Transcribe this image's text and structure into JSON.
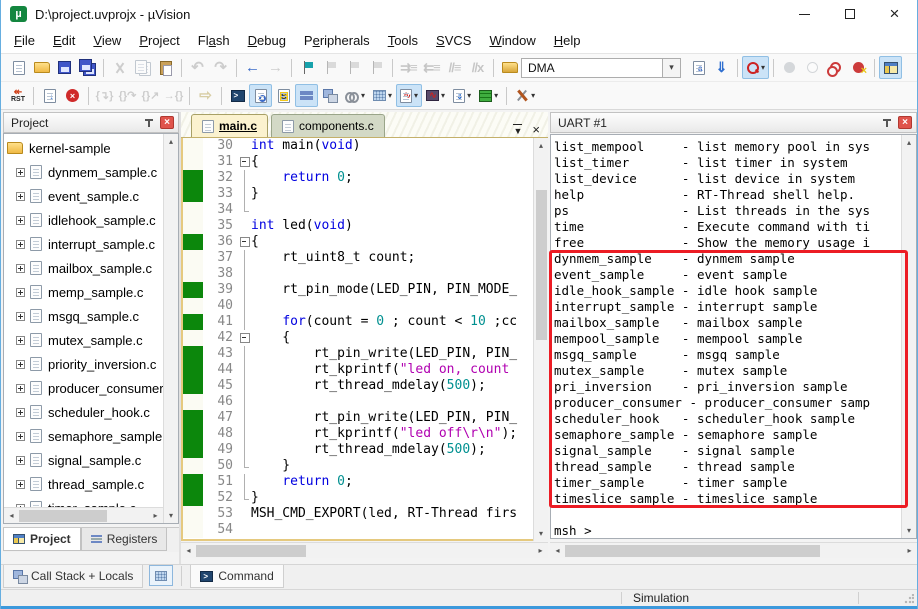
{
  "window": {
    "title": "D:\\project.uvprojx - µVision"
  },
  "menu": {
    "items": [
      {
        "label": "File",
        "u": 0
      },
      {
        "label": "Edit",
        "u": 0
      },
      {
        "label": "View",
        "u": 0
      },
      {
        "label": "Project",
        "u": 0
      },
      {
        "label": "Flash",
        "u": 2
      },
      {
        "label": "Debug",
        "u": 0
      },
      {
        "label": "Peripherals",
        "u": 1
      },
      {
        "label": "Tools",
        "u": 0
      },
      {
        "label": "SVCS",
        "u": 0
      },
      {
        "label": "Window",
        "u": 0
      },
      {
        "label": "Help",
        "u": 0
      }
    ]
  },
  "toolbar": {
    "search_value": "DMA"
  },
  "project_panel": {
    "title": "Project",
    "root": "kernel-sample",
    "files": [
      "dynmem_sample.c",
      "event_sample.c",
      "idlehook_sample.c",
      "interrupt_sample.c",
      "mailbox_sample.c",
      "memp_sample.c",
      "msgq_sample.c",
      "mutex_sample.c",
      "priority_inversion.c",
      "producer_consumer.c",
      "scheduler_hook.c",
      "semaphore_sample.c",
      "signal_sample.c",
      "thread_sample.c",
      "timer_sample.c",
      "timeslice_sample.c"
    ],
    "tabs": [
      "Project",
      "Registers"
    ]
  },
  "editor": {
    "tabs": [
      "main.c",
      "components.c"
    ],
    "active_tab": "main.c",
    "lines": [
      {
        "no": 30,
        "text": "int main(void)",
        "cov": false,
        "fold": ""
      },
      {
        "no": 31,
        "text": "{",
        "cov": false,
        "fold": "open"
      },
      {
        "no": 32,
        "text": "    return 0;",
        "cov": true,
        "fold": "line"
      },
      {
        "no": 33,
        "text": "}",
        "cov": true,
        "fold": "line"
      },
      {
        "no": 34,
        "text": "",
        "cov": false,
        "fold": "end"
      },
      {
        "no": 35,
        "text": "int led(void)",
        "cov": false,
        "fold": ""
      },
      {
        "no": 36,
        "text": "{",
        "cov": true,
        "fold": "open"
      },
      {
        "no": 37,
        "text": "    rt_uint8_t count;",
        "cov": false,
        "fold": "line"
      },
      {
        "no": 38,
        "text": "",
        "cov": false,
        "fold": "line"
      },
      {
        "no": 39,
        "text": "    rt_pin_mode(LED_PIN, PIN_MODE_",
        "cov": true,
        "fold": "line"
      },
      {
        "no": 40,
        "text": "",
        "cov": false,
        "fold": "line"
      },
      {
        "no": 41,
        "text": "    for(count = 0 ; count < 10 ;cc",
        "cov": true,
        "fold": "line"
      },
      {
        "no": 42,
        "text": "    {",
        "cov": false,
        "fold": "open"
      },
      {
        "no": 43,
        "text": "        rt_pin_write(LED_PIN, PIN_",
        "cov": true,
        "fold": "line"
      },
      {
        "no": 44,
        "text": "        rt_kprintf(\"led on, count ",
        "cov": true,
        "fold": "line"
      },
      {
        "no": 45,
        "text": "        rt_thread_mdelay(500);",
        "cov": true,
        "fold": "line"
      },
      {
        "no": 46,
        "text": "",
        "cov": false,
        "fold": "line"
      },
      {
        "no": 47,
        "text": "        rt_pin_write(LED_PIN, PIN_",
        "cov": true,
        "fold": "line"
      },
      {
        "no": 48,
        "text": "        rt_kprintf(\"led off\\r\\n\");",
        "cov": true,
        "fold": "line"
      },
      {
        "no": 49,
        "text": "        rt_thread_mdelay(500);",
        "cov": true,
        "fold": "line"
      },
      {
        "no": 50,
        "text": "    }",
        "cov": false,
        "fold": "end"
      },
      {
        "no": 51,
        "text": "    return 0;",
        "cov": true,
        "fold": "line"
      },
      {
        "no": 52,
        "text": "}",
        "cov": true,
        "fold": "end"
      },
      {
        "no": 53,
        "text": "MSH_CMD_EXPORT(led, RT-Thread firs",
        "cov": false,
        "fold": ""
      },
      {
        "no": 54,
        "text": "",
        "cov": false,
        "fold": ""
      }
    ]
  },
  "uart": {
    "title": "UART #1",
    "lines": [
      "list_mempool     - list memory pool in sys",
      "list_timer       - list timer in system",
      "list_device      - list device in system",
      "help             - RT-Thread shell help.",
      "ps               - List threads in the sys",
      "time             - Execute command with ti",
      "free             - Show the memory usage i",
      "dynmem_sample    - dynmem sample",
      "event_sample     - event sample",
      "idle_hook_sample - idle hook sample",
      "interrupt_sample - interrupt sample",
      "mailbox_sample   - mailbox sample",
      "mempool_sample   - mempool sample",
      "msgq_sample      - msgq sample",
      "mutex_sample     - mutex sample",
      "pri_inversion    - pri_inversion sample",
      "producer_consumer - producer_consumer samp",
      "scheduler_hook   - scheduler_hook sample",
      "semaphore_sample - semaphore sample",
      "signal_sample    - signal sample",
      "thread_sample    - thread sample",
      "timer_sample     - timer sample",
      "timeslice_sample - timeslice sample",
      "",
      "msh >"
    ]
  },
  "bottom": {
    "call_stack_label": "Call Stack + Locals",
    "command_label": "Command"
  },
  "status": {
    "mode": "Simulation"
  },
  "colors": {
    "accent": "#3c99dc",
    "annotation": "#ec1c24",
    "coverage": "#0c870c"
  }
}
